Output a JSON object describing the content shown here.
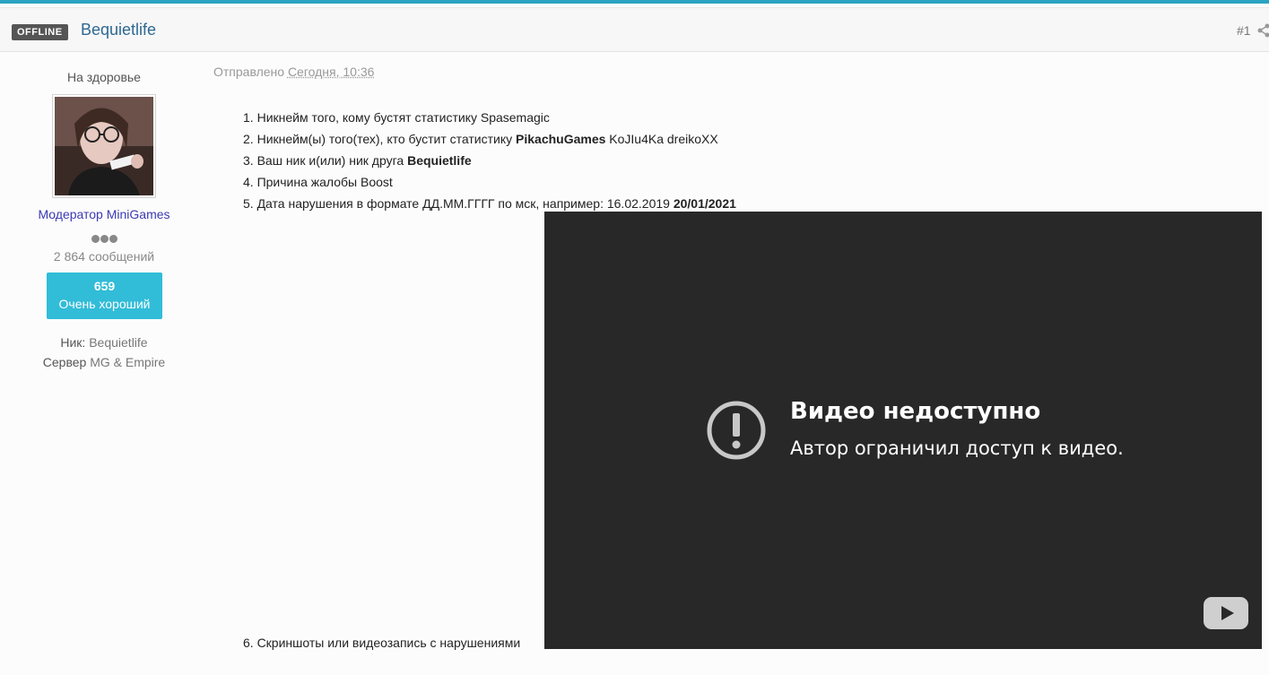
{
  "header": {
    "status_badge": "OFFLINE",
    "author_name": "Bequietlife",
    "post_number": "#1"
  },
  "sidebar": {
    "user_title": "На здоровье",
    "group_name": "Модератор MiniGames",
    "post_count": "2 864 сообщений",
    "reputation": {
      "value": "659",
      "label": "Очень хороший"
    },
    "fields": [
      {
        "label": "Ник:",
        "value": "Bequietlife"
      },
      {
        "label": "Сервер",
        "value": "MG & Empire"
      }
    ]
  },
  "post": {
    "date_prefix": "Отправлено",
    "date_value": "Сегодня, 10:36",
    "items": [
      {
        "num": "1.",
        "text": "Никнейм того, кому бустят статистику Spasemagic",
        "bold": "",
        "tail": ""
      },
      {
        "num": "2.",
        "text": "Никнейм(ы) того(тех), кто бустит статистику ",
        "bold": "PikachuGames",
        "tail": " KoJIu4Ka dreikoXX"
      },
      {
        "num": "3.",
        "text": "Ваш ник и(или) ник друга ",
        "bold": "Bequietlife",
        "tail": ""
      },
      {
        "num": "4.",
        "text": "Причина жалобы Boost",
        "bold": "",
        "tail": ""
      },
      {
        "num": "5.",
        "text": "Дата нарушения в формате ДД.ММ.ГГГГ по мск, например: 16.02.2019 ",
        "bold": "20/01/2021",
        "tail": ""
      }
    ],
    "item6": "6. Скриншоты или видеозапись с нарушениями"
  },
  "video": {
    "title": "Видео недоступно",
    "subtitle": "Автор ограничил доступ к видео.",
    "alert_icon": "exclamation-circle-icon",
    "play_icon": "youtube-play-icon"
  },
  "colors": {
    "accent": "#2aa3c2",
    "author_link": "#2e6893",
    "group": "#3b39b4",
    "reputation_bg": "#31bcd8",
    "video_bg": "#282828"
  }
}
